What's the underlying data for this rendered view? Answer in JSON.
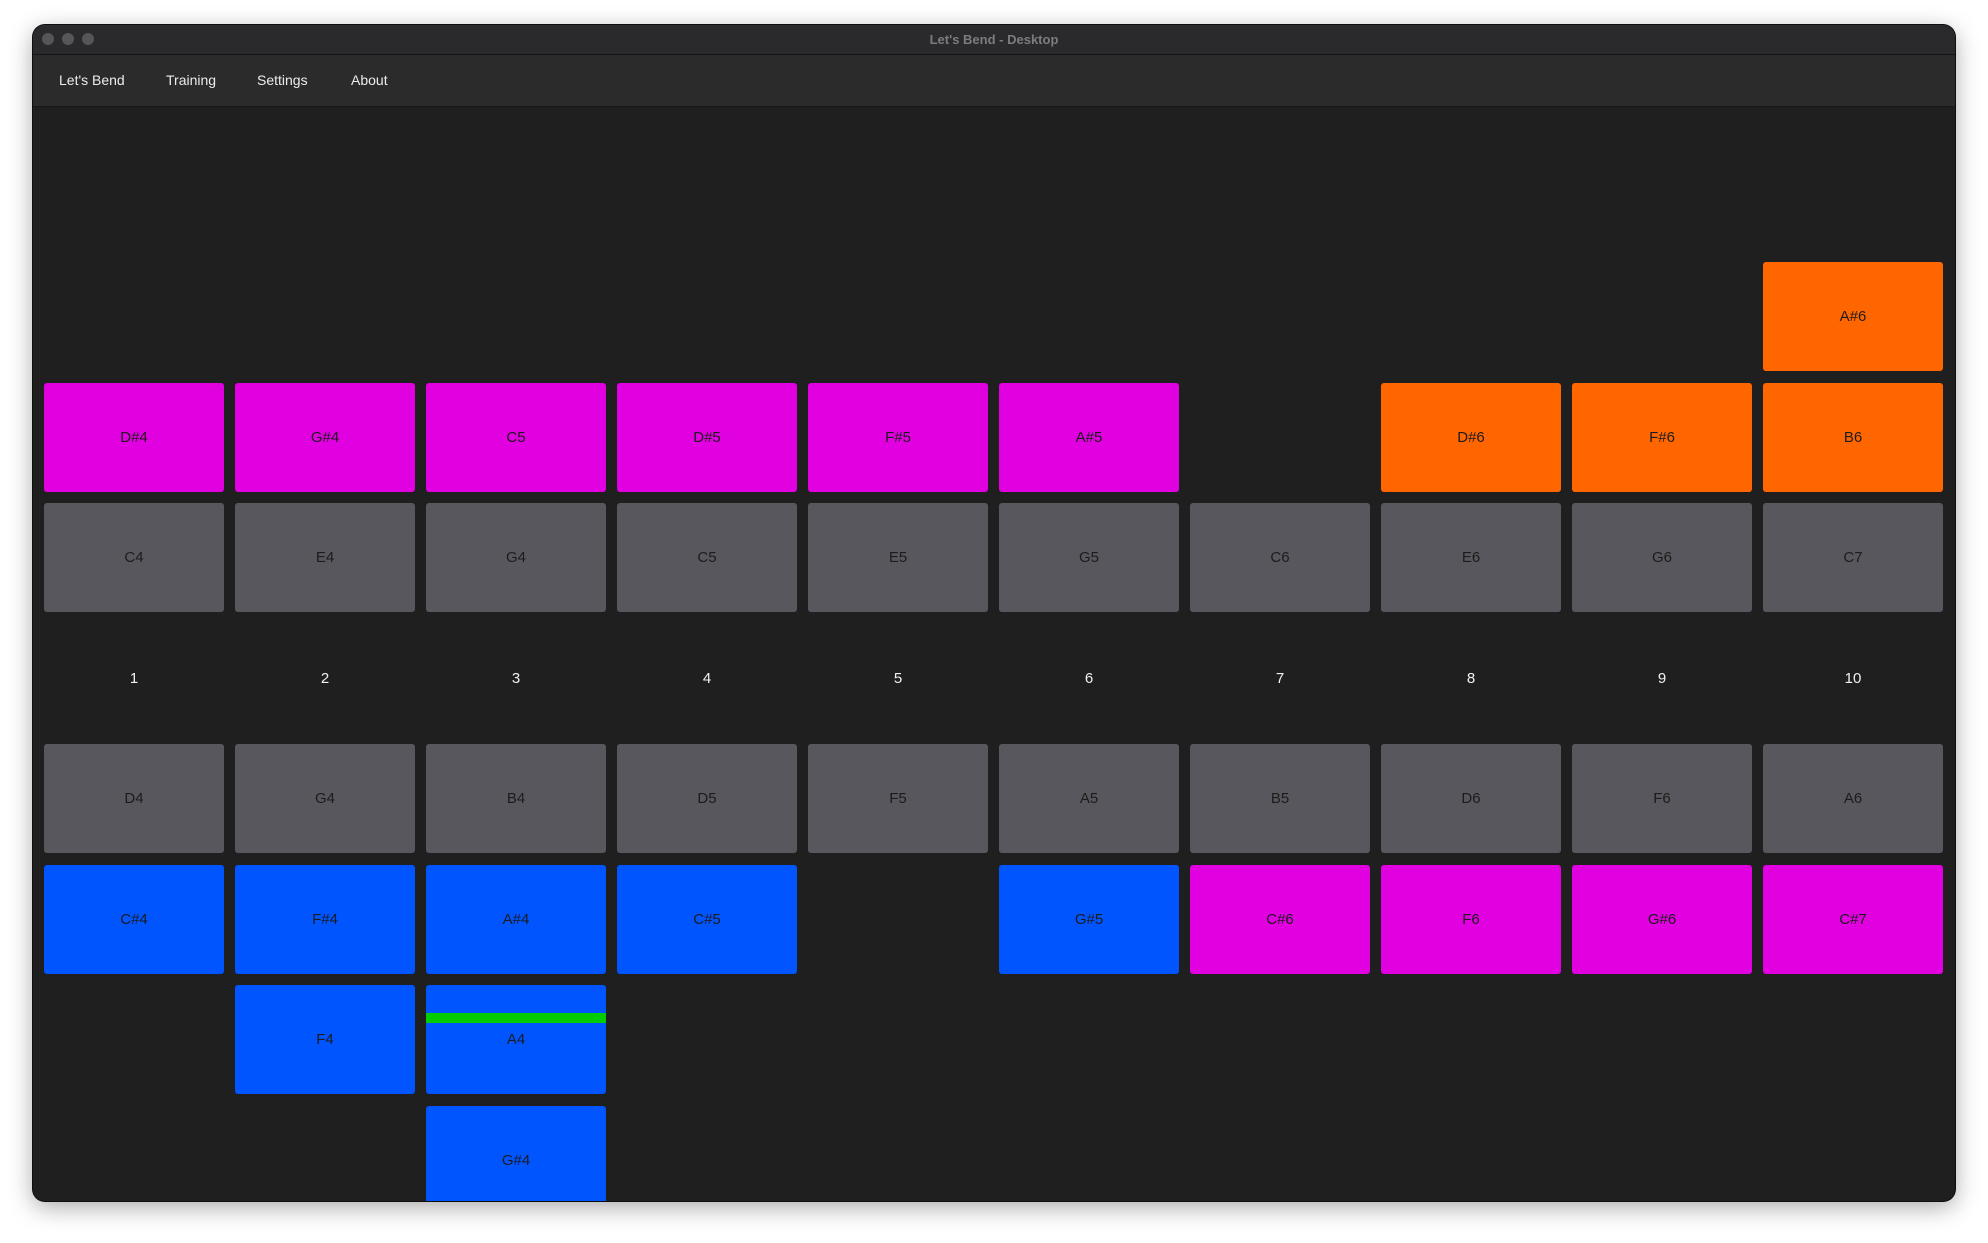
{
  "window": {
    "title": "Let's Bend - Desktop"
  },
  "menu": [
    {
      "label": "Let's Bend"
    },
    {
      "label": "Training"
    },
    {
      "label": "Settings"
    },
    {
      "label": "About"
    }
  ],
  "colors": {
    "background": "#1f1f1f",
    "natural": "#58575d",
    "blow_bend": "#ff6600",
    "overblow_overdraw": "#e000e0",
    "draw_bend": "#0055ff",
    "pitch_indicator": "#00cc00"
  },
  "holes": [
    "1",
    "2",
    "3",
    "4",
    "5",
    "6",
    "7",
    "8",
    "9",
    "10"
  ],
  "rows": [
    {
      "row": "blow-bend",
      "cells": [
        null,
        null,
        null,
        null,
        null,
        null,
        null,
        null,
        null,
        {
          "note": "A#6",
          "type": "blow-bend"
        }
      ]
    },
    {
      "row": "upper",
      "cells": [
        {
          "note": "D#4",
          "type": "overblow"
        },
        {
          "note": "G#4",
          "type": "overblow"
        },
        {
          "note": "C5",
          "type": "overblow"
        },
        {
          "note": "D#5",
          "type": "overblow"
        },
        {
          "note": "F#5",
          "type": "overblow"
        },
        {
          "note": "A#5",
          "type": "overblow"
        },
        null,
        {
          "note": "D#6",
          "type": "blow-bend"
        },
        {
          "note": "F#6",
          "type": "blow-bend"
        },
        {
          "note": "B6",
          "type": "blow-bend"
        }
      ]
    },
    {
      "row": "blow",
      "cells": [
        {
          "note": "C4",
          "type": "natural"
        },
        {
          "note": "E4",
          "type": "natural"
        },
        {
          "note": "G4",
          "type": "natural"
        },
        {
          "note": "C5",
          "type": "natural"
        },
        {
          "note": "E5",
          "type": "natural"
        },
        {
          "note": "G5",
          "type": "natural"
        },
        {
          "note": "C6",
          "type": "natural"
        },
        {
          "note": "E6",
          "type": "natural"
        },
        {
          "note": "G6",
          "type": "natural"
        },
        {
          "note": "C7",
          "type": "natural"
        }
      ]
    },
    {
      "row": "hole-numbers",
      "cells": []
    },
    {
      "row": "draw",
      "cells": [
        {
          "note": "D4",
          "type": "natural"
        },
        {
          "note": "G4",
          "type": "natural"
        },
        {
          "note": "B4",
          "type": "natural"
        },
        {
          "note": "D5",
          "type": "natural"
        },
        {
          "note": "F5",
          "type": "natural"
        },
        {
          "note": "A5",
          "type": "natural"
        },
        {
          "note": "B5",
          "type": "natural"
        },
        {
          "note": "D6",
          "type": "natural"
        },
        {
          "note": "F6",
          "type": "natural"
        },
        {
          "note": "A6",
          "type": "natural"
        }
      ]
    },
    {
      "row": "lower-1",
      "cells": [
        {
          "note": "C#4",
          "type": "draw-bend"
        },
        {
          "note": "F#4",
          "type": "draw-bend"
        },
        {
          "note": "A#4",
          "type": "draw-bend"
        },
        {
          "note": "C#5",
          "type": "draw-bend"
        },
        null,
        {
          "note": "G#5",
          "type": "draw-bend"
        },
        {
          "note": "C#6",
          "type": "overdraw"
        },
        {
          "note": "F6",
          "type": "overdraw"
        },
        {
          "note": "G#6",
          "type": "overdraw"
        },
        {
          "note": "C#7",
          "type": "overdraw"
        }
      ]
    },
    {
      "row": "lower-2",
      "cells": [
        null,
        {
          "note": "F4",
          "type": "draw-bend"
        },
        {
          "note": "A4",
          "type": "draw-bend",
          "active": true,
          "pitch_offset": 0.7
        },
        null,
        null,
        null,
        null,
        null,
        null,
        null
      ]
    },
    {
      "row": "lower-3",
      "cells": [
        null,
        null,
        {
          "note": "G#4",
          "type": "draw-bend"
        },
        null,
        null,
        null,
        null,
        null,
        null,
        null
      ]
    }
  ]
}
